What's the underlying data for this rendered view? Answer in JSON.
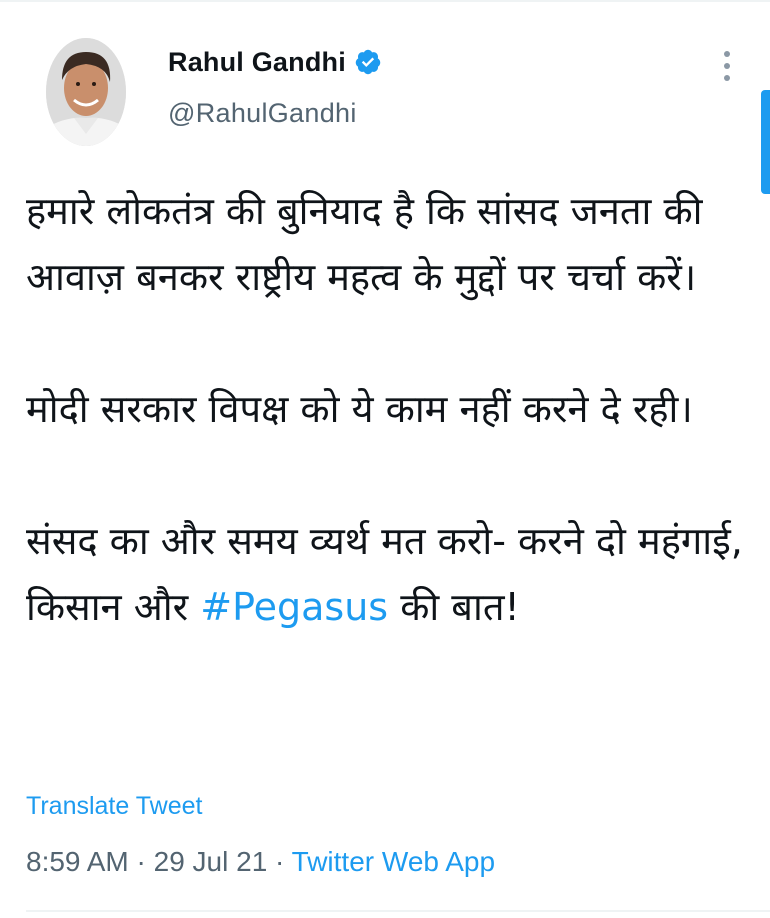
{
  "tweet": {
    "author": {
      "display_name": "Rahul Gandhi",
      "handle": "@RahulGandhi",
      "verified": true
    },
    "paragraphs": [
      "हमारे लोकतंत्र की बुनियाद है कि सांसद जनता की आवाज़ बनकर राष्ट्रीय महत्व के मुद्दों पर चर्चा करें।",
      "मोदी सरकार विपक्ष को ये काम नहीं करने दे रही।"
    ],
    "last_paragraph": {
      "before": "संसद का और समय व्यर्थ मत करो- करने दो महंगाई, किसान और ",
      "hashtag": "#Pegasus",
      "after": " की बात!"
    },
    "translate_label": "Translate Tweet",
    "time": "8:59 AM",
    "separator": "·",
    "date": "29 Jul 21",
    "source": "Twitter Web App"
  },
  "colors": {
    "accent": "#1d9bf0",
    "text": "#0f1419",
    "secondary": "#536471"
  },
  "icons": {
    "verified": "verified-badge-icon",
    "more": "more-options-icon"
  }
}
